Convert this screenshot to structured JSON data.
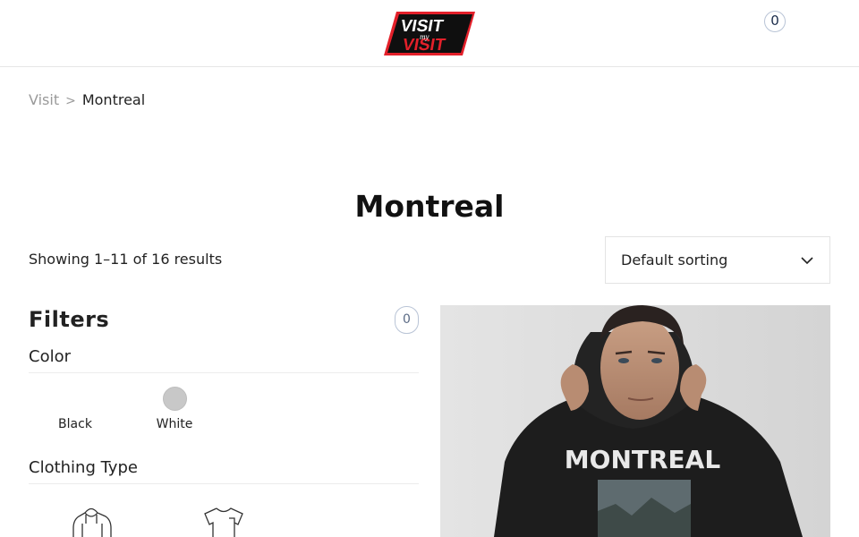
{
  "header": {
    "logo": {
      "line1": "VISIT",
      "line2": "VISIT",
      "script_text": "my"
    },
    "cart_count": "0"
  },
  "breadcrumb": {
    "parent": "Visit",
    "separator": ">",
    "current": "Montreal"
  },
  "page_title": "Montreal",
  "toolbar": {
    "results_count": "Showing 1–11 of 16 results",
    "sort_value": "Default sorting"
  },
  "filters": {
    "title": "Filters",
    "active_count": "0",
    "color": {
      "title": "Color",
      "options": [
        {
          "label": "Black",
          "color": "#ffffff"
        },
        {
          "label": "White",
          "color": "#c8c8c8"
        }
      ]
    },
    "clothing_type": {
      "title": "Clothing Type",
      "options": [
        {
          "icon": "hoodie-icon"
        },
        {
          "icon": "t-shirt-icon"
        }
      ]
    }
  },
  "product": {
    "print_text": "MONTREAL"
  }
}
